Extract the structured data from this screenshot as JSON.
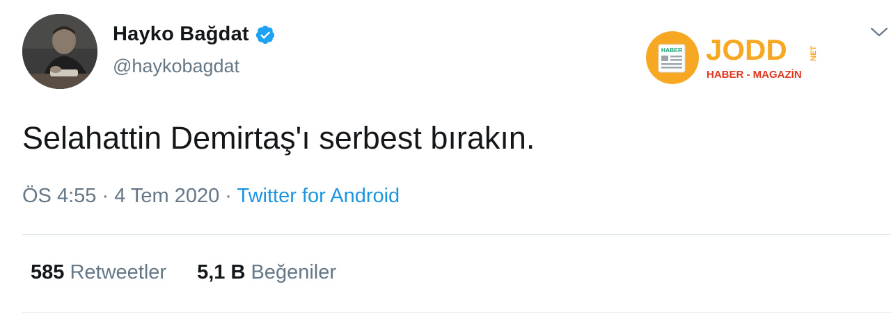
{
  "user": {
    "display_name": "Hayko Bağdat",
    "handle": "@haykobagdat",
    "verified": true
  },
  "tweet": {
    "text": "Selahattin Demirtaş'ı serbest bırakın.",
    "time": "ÖS 4:55",
    "separator": " · ",
    "date": "4 Tem 2020",
    "source": "Twitter for Android"
  },
  "stats": {
    "retweets_count": "585",
    "retweets_label": "Retweetler",
    "likes_count": "5,1 B",
    "likes_label": "Beğeniler"
  },
  "watermark": {
    "badge_text": "HABER",
    "brand": "JODD",
    "suffix": "NET",
    "tagline": "HABER - MAGAZİN"
  },
  "colors": {
    "text_primary": "#14171a",
    "text_secondary": "#657786",
    "link": "#1b95e0",
    "verified": "#1da1f2",
    "divider": "#e1e8ed",
    "watermark_orange": "#f7a823",
    "watermark_red": "#e0371f"
  },
  "icons": {
    "verified": "verified-badge-icon",
    "menu": "chevron-down-icon"
  }
}
